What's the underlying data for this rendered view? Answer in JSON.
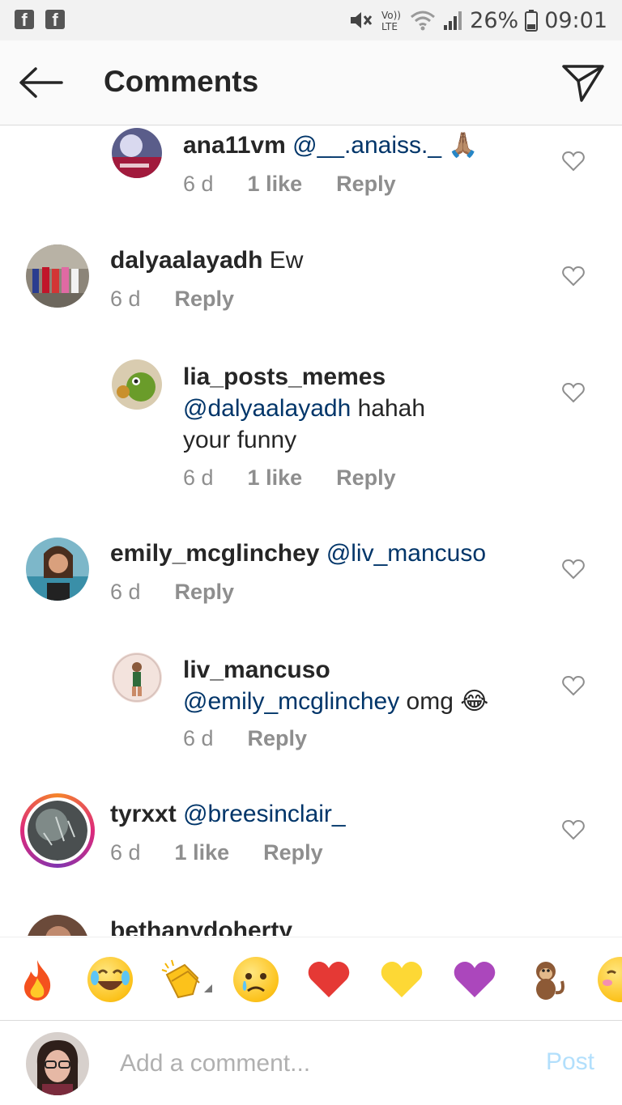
{
  "status_bar": {
    "left_icons": [
      "facebook-icon",
      "facebook-icon"
    ],
    "battery_percent": "26%",
    "time": "09:01",
    "network": "LTE",
    "volte": "Vo))"
  },
  "header": {
    "title": "Comments",
    "back_icon": "arrow-left-icon",
    "share_icon": "paper-plane-icon"
  },
  "comments": [
    {
      "username": "ana11vm",
      "text": "",
      "mention": "@__.anaiss._",
      "emoji": "🙏🏽",
      "time": "6 d",
      "likes": "1 like",
      "reply": "Reply",
      "reply_level": 1
    },
    {
      "username": "dalyaalayadh",
      "text": "Ew",
      "mention": "",
      "time": "6 d",
      "likes": "",
      "reply": "Reply",
      "reply_level": 0
    },
    {
      "username": "lia_posts_memes",
      "mention": "@dalyaalayadh",
      "text": "hahah",
      "text2": "your funny",
      "time": "6 d",
      "likes": "1 like",
      "reply": "Reply",
      "reply_level": 1
    },
    {
      "username": "emily_mcglinchey",
      "mention": "@liv_mancuso",
      "text": "",
      "time": "6 d",
      "likes": "",
      "reply": "Reply",
      "reply_level": 0
    },
    {
      "username": "liv_mancuso",
      "mention": "@emily_mcglinchey",
      "text": "omg",
      "emoji": "😂",
      "time": "6 d",
      "likes": "",
      "reply": "Reply",
      "reply_level": 1
    },
    {
      "username": "tyrxxt",
      "mention": "@breesinclair_",
      "text": "",
      "time": "6 d",
      "likes": "1 like",
      "reply": "Reply",
      "reply_level": 0
    },
    {
      "username": "bethanydoherty",
      "mention": "",
      "text": "",
      "time": "",
      "likes": "",
      "reply": "",
      "reply_level": 0
    }
  ],
  "emoji_bar": [
    "🔥",
    "😂",
    "👏",
    "😢",
    "❤️",
    "💛",
    "💜",
    "🐒",
    "😊"
  ],
  "input": {
    "placeholder": "Add a comment...",
    "post_label": "Post"
  },
  "colors": {
    "mention": "#003569",
    "meta": "#8e8e8e",
    "post_disabled": "#b2dffc",
    "story_ring": [
      "#f58529",
      "#dd2a7b",
      "#8134af"
    ]
  }
}
